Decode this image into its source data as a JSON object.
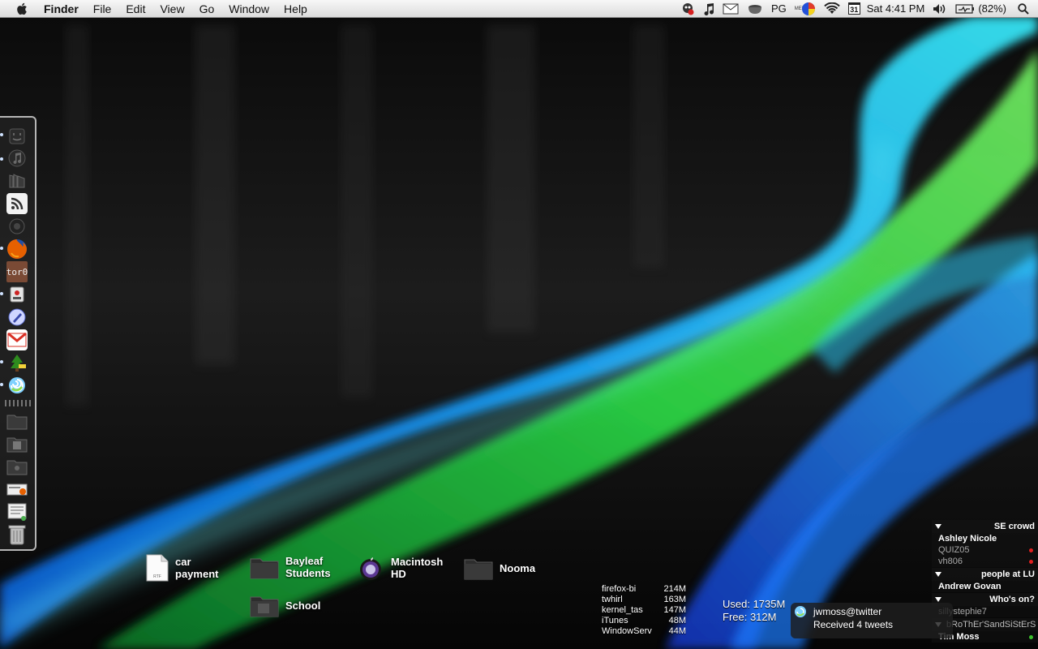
{
  "menubar": {
    "app_name": "Finder",
    "menus": [
      "File",
      "Edit",
      "View",
      "Go",
      "Window",
      "Help"
    ],
    "input_source": "PG",
    "mem_label": "MEM",
    "calendar_day": "31",
    "clock": "Sat 4:41 PM",
    "battery": "(82%)"
  },
  "desktop": {
    "icons": [
      {
        "label": "car\npayment",
        "kind": "rtf-document",
        "badge": "RTF"
      },
      {
        "label": "Bayleaf\nStudents",
        "kind": "folder"
      },
      {
        "label": "Macintosh\nHD",
        "kind": "hard-drive"
      },
      {
        "label": "Nooma",
        "kind": "folder"
      },
      {
        "label": "School",
        "kind": "folder"
      }
    ]
  },
  "dock": {
    "items": [
      {
        "name": "finder-stack-icon",
        "running": true
      },
      {
        "name": "itunes-icon",
        "running": true
      },
      {
        "name": "bookshelf-icon",
        "running": false
      },
      {
        "name": "rss-feed-icon",
        "running": false,
        "color": "#f7f7f7"
      },
      {
        "name": "webcam-icon",
        "running": false
      },
      {
        "name": "firefox-icon",
        "running": true,
        "color": "#e66000"
      },
      {
        "name": "tor-icon",
        "running": false,
        "label": "tor0",
        "color": "#7a4a35"
      },
      {
        "name": "security-app-icon",
        "running": true
      },
      {
        "name": "compose-icon",
        "running": false
      },
      {
        "name": "gmail-icon",
        "running": false,
        "color": "#d93025"
      },
      {
        "name": "tree-app-icon",
        "running": true
      },
      {
        "name": "twhirl-icon",
        "running": true
      },
      {
        "name": "folder-stack-icon",
        "running": false
      },
      {
        "name": "documents-stack-icon",
        "running": false
      },
      {
        "name": "pictures-stack-icon",
        "running": false
      },
      {
        "name": "downloads-stack-icon",
        "running": false
      },
      {
        "name": "applications-stack-icon",
        "running": false
      },
      {
        "name": "trash-icon",
        "running": false
      }
    ]
  },
  "processes": [
    {
      "name": "firefox-bi",
      "mem": "214M"
    },
    {
      "name": "twhirl",
      "mem": "163M"
    },
    {
      "name": "kernel_tas",
      "mem": "147M"
    },
    {
      "name": "iTunes",
      "mem": "48M"
    },
    {
      "name": "WindowServ",
      "mem": "44M"
    }
  ],
  "memory": {
    "used": "Used: 1735M",
    "free": "Free: 312M"
  },
  "buddy_list": {
    "groups": [
      {
        "name": "SE crowd",
        "buddies": [
          {
            "name": "Ashley Nicole",
            "idle": false,
            "status_color": null
          },
          {
            "name": "QUIZ05",
            "idle": true,
            "status_color": "#e02020"
          },
          {
            "name": "vh806",
            "idle": true,
            "status_color": "#e02020"
          }
        ]
      },
      {
        "name": "people at LU",
        "buddies": [
          {
            "name": "Andrew Govan",
            "idle": false,
            "status_color": null
          }
        ]
      },
      {
        "name": "Who's on?",
        "buddies": [
          {
            "name": "sillystephie7",
            "idle": true,
            "status_color": null
          }
        ]
      },
      {
        "name": "bRoThEr'SandSiStErS",
        "buddies": [
          {
            "name": "Tim Moss",
            "idle": false,
            "status_color": "#3bbf2b"
          }
        ]
      }
    ]
  },
  "growl": {
    "title": "jwmoss@twitter",
    "message": "Received 4 tweets"
  }
}
